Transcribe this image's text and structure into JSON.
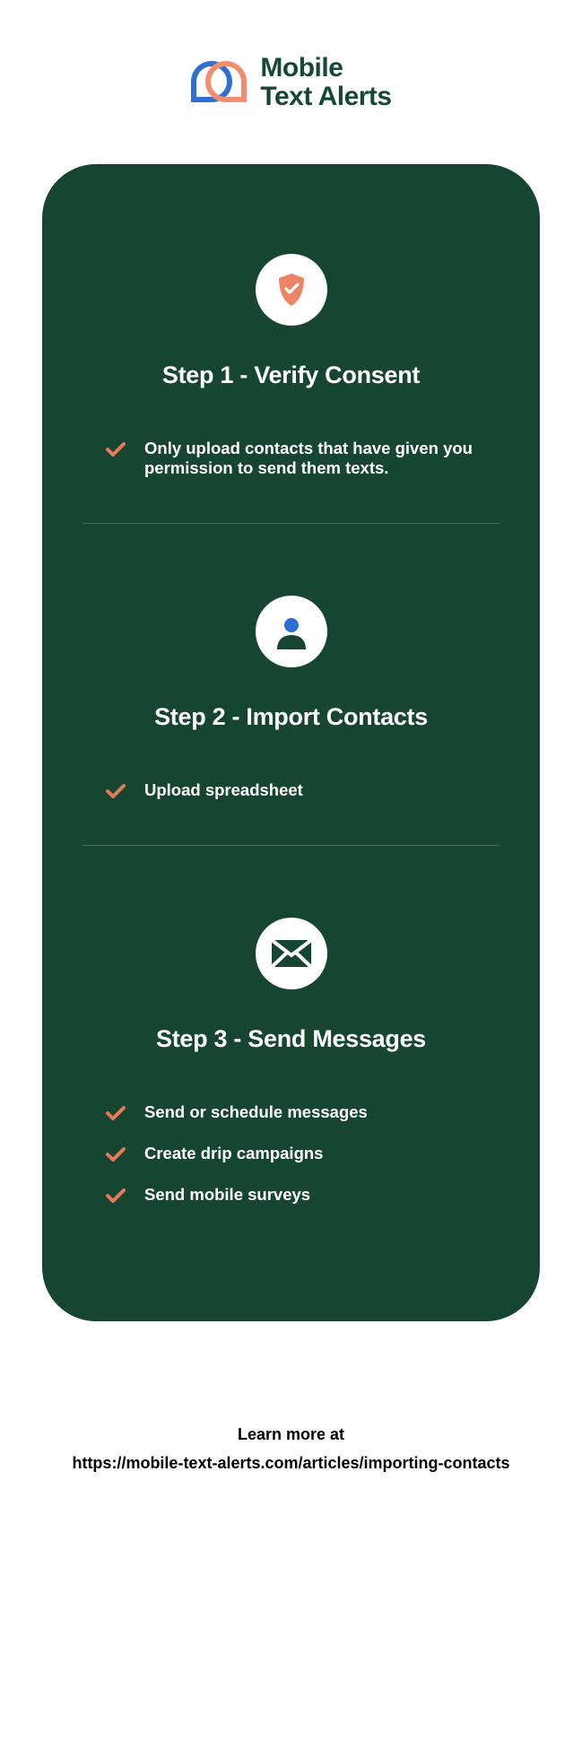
{
  "logo": {
    "line1": "Mobile",
    "line2": "Text Alerts"
  },
  "steps": [
    {
      "title": "Step 1 - Verify Consent",
      "items": [
        "Only upload contacts that have given you permission to send them texts."
      ]
    },
    {
      "title": "Step 2 - Import Contacts",
      "items": [
        "Upload spreadsheet"
      ]
    },
    {
      "title": "Step 3 - Send Messages",
      "items": [
        "Send or schedule messages",
        "Create drip campaigns",
        "Send mobile surveys"
      ]
    }
  ],
  "footer": {
    "line1": "Learn more at",
    "line2": "https://mobile-text-alerts.com/articles/importing-contacts"
  }
}
